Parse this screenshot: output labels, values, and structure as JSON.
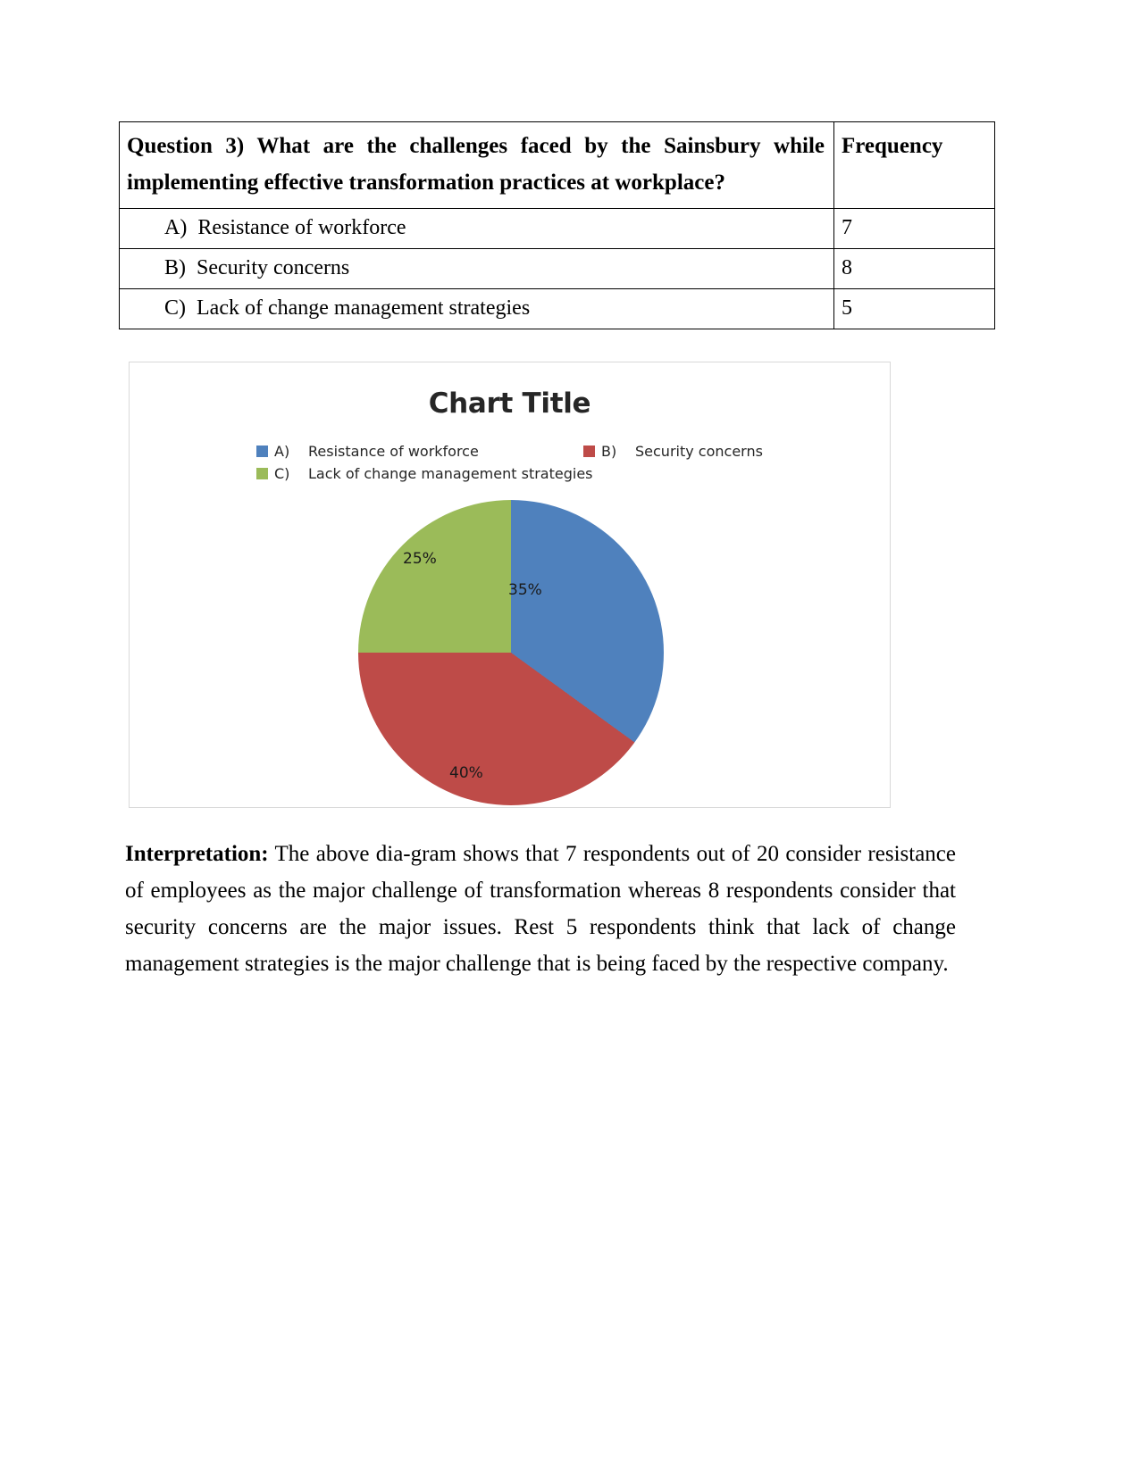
{
  "table": {
    "question": "Question 3) What are the challenges faced by the Sainsbury while implementing effective transformation practices at workplace?",
    "question_line1": "Question 3) What are the challenges faced by the Sainsbury while",
    "question_line2": "implementing effective transformation practices at workplace?",
    "frequency_header": "Frequency",
    "rows": [
      {
        "option": "A)  Resistance of workforce",
        "frequency": "7"
      },
      {
        "option": "B)  Security concerns",
        "frequency": "8"
      },
      {
        "option": "C)  Lack of change management strategies",
        "frequency": "5"
      }
    ]
  },
  "chart": {
    "title": "Chart Title",
    "legend": [
      {
        "key": "A)",
        "label": "Resistance of workforce",
        "color": "#4F81BD"
      },
      {
        "key": "B)",
        "label": "Security concerns",
        "color": "#BE4B48"
      },
      {
        "key": "C)",
        "label": "Lack of change management strategies",
        "color": "#9BBB59"
      }
    ],
    "labels": {
      "a": "35%",
      "b": "40%",
      "c": "25%"
    }
  },
  "chart_data": {
    "type": "pie",
    "title": "Chart Title",
    "categories": [
      "A)   Resistance of workforce",
      "B)   Security concerns",
      "C)   Lack of change management strategies"
    ],
    "values": [
      7,
      8,
      5
    ],
    "percentages": [
      35,
      40,
      25
    ],
    "data_labels": [
      "35%",
      "40%",
      "25%"
    ],
    "colors": [
      "#4F81BD",
      "#BE4B48",
      "#9BBB59"
    ],
    "total": 20,
    "legend_position": "top",
    "start_angle": 0,
    "direction": "clockwise",
    "grid": false,
    "xlabel": "",
    "ylabel": ""
  },
  "interpretation": {
    "lead": "Interpretation:",
    "body": " The above dia-gram shows that 7 respondents out of 20 consider resistance of employees as the major challenge of transformation whereas 8 respondents consider that security concerns are the major issues. Rest 5 respondents think that lack of change management strategies is the major challenge that is being faced by the respective company."
  }
}
